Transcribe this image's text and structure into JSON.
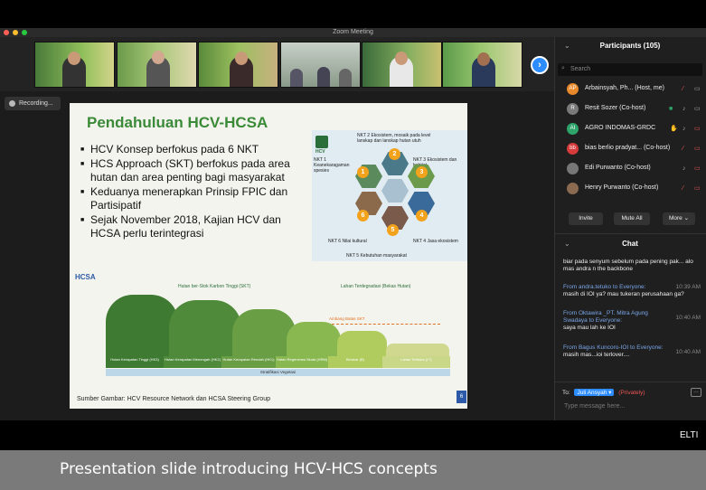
{
  "window": {
    "title": "Zoom Meeting"
  },
  "recording": {
    "label": "Recording..."
  },
  "slide": {
    "title": "Pendahuluan HCV-HCSA",
    "bullets": [
      "HCV Konsep berfokus pada 6 NKT",
      "HCS Approach (SKT) berfokus pada area hutan dan area penting bagi masyarakat",
      "Keduanya menerapkan Prinsip FPIC dan Partisipatif",
      "Sejak November 2018, Kajian HCV dan HCSA perlu terintegrasi"
    ],
    "diagram": {
      "nkt1": "NKT 1 Keanekaragaman spesies",
      "nkt2": "NKT 2 Ekosistem, mosaik pada level lanskap dan lanskap hutan utuh",
      "nkt3": "NKT 3 Ekosistem dan habitat",
      "nkt4": "NKT 4 Jasa ekosistem",
      "nkt5": "NKT 5 Kebutuhan masyarakat",
      "nkt6": "NKT 6 Nilai kultural",
      "numbers": [
        "1",
        "2",
        "3",
        "4",
        "5",
        "6"
      ],
      "logo": "HCV"
    },
    "landscape": {
      "logo": "HCSA",
      "label_skt": "Hutan ber-Stok Karbon Tinggi (SKT)",
      "label_degraded": "Lahan Terdegradasi (Bekas Hutan)",
      "threshold": "Ambang Batas SKT",
      "bands": [
        "Hutan Kerapatan Tinggi (HK3)",
        "Hutan Kerapatan Menengah (HK2)",
        "Hutan Kerapatan Rendah (HK1)",
        "Hutan Regenerasi Muda (HRM)",
        "Belukar (B)",
        "Lahan Terbuka (LT)"
      ],
      "strat": "Stratifikasi Vegetasi"
    },
    "source": "Sumber Gambar: HCV Resource Network dan HCSA Steering Group",
    "page": "6"
  },
  "participants": {
    "header": "Participants (105)",
    "search_placeholder": "Search",
    "list": [
      {
        "initials": "AP",
        "name": "Arbainsyah, Ph... (Host, me)",
        "color": "#e8892b"
      },
      {
        "initials": "R",
        "name": "Resit Sozer (Co-host)",
        "color": "#7a7a7a"
      },
      {
        "initials": "AI",
        "name": "AGRO INDOMAS-GRDC",
        "color": "#2ea36a"
      },
      {
        "initials": "bb",
        "name": "bias berlio pradyat... (Co-host)",
        "color": "#d63b3b"
      },
      {
        "initials": "",
        "name": "Edi Purwanto (Co-host)",
        "color": "#777"
      },
      {
        "initials": "",
        "name": "Henry Purwanto (Co-host)",
        "color": "#8a6a50"
      }
    ],
    "invite": "Invite",
    "mute_all": "Mute All",
    "more": "More ⌄"
  },
  "chat": {
    "header": "Chat",
    "messages": [
      {
        "from": "",
        "time": "",
        "text": "biar pada senyum sebelum pada pening pak... alo mas andra n the backbone"
      },
      {
        "from": "From andra.tetuko to Everyone:",
        "time": "10:39 AM",
        "text": "masih di IOI ya? mau tukeran perusahaan ga?"
      },
      {
        "from": "From Oktawira _PT. Mitra Agung Swadaya to Everyone:",
        "time": "10:40 AM",
        "text": "saya mau lah ke IOI"
      },
      {
        "from": "From Bagus Kuncoro-IOI to Everyone:",
        "time": "10:40 AM",
        "text": "masih mas...ioi terlover...."
      }
    ],
    "to_label": "To:",
    "to_target": "Juli Ansyah ▾",
    "privately": "(Privately)",
    "placeholder": "Type message here..."
  },
  "watermark": "ELTI",
  "caption": "Presentation slide introducing HCV-HCS concepts"
}
